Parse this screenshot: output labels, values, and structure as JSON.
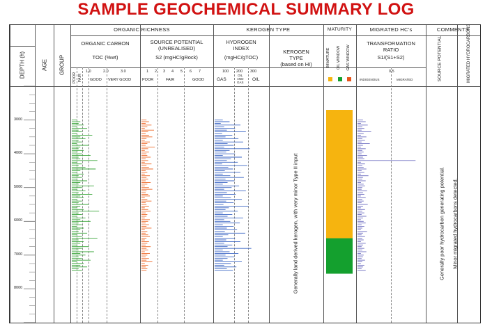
{
  "title": "SAMPLE GEOCHEMICAL SUMMARY LOG",
  "header": {
    "depth_label": "DEPTH (ft)",
    "age_label": "AGE",
    "group_label": "GROUP",
    "organic_richness": "ORGANIC RICHNESS",
    "kerogen_type": "KEROGEN TYPE",
    "maturity": "MATURITY",
    "migrated": "MIGRATED HC's",
    "comments": "COMMENTS"
  },
  "columns": {
    "organic_carbon": {
      "title": "ORGANIC CARBON",
      "unit": "TOC (%wt)",
      "ticks": [
        "1.0",
        "2.0",
        "3.0"
      ],
      "classes": [
        "POOR",
        "FAIR",
        "GOOD",
        "VERY GOOD"
      ]
    },
    "source_potential": {
      "title_1": "SOURCE POTENTIAL",
      "title_2": "(UNREALISED)",
      "unit": "S2 (mgHC/gRock)",
      "ticks": [
        "1",
        "2",
        "3",
        "4",
        "5",
        "6",
        "7"
      ],
      "classes": [
        "POOR",
        "FAIR",
        "GOOD"
      ]
    },
    "hydrogen_index": {
      "title_1": "HYDROGEN",
      "title_2": "INDEX",
      "unit": "(mgHC/gTOC)",
      "ticks": [
        "100",
        "200",
        "300"
      ],
      "classes": [
        "GAS",
        "OIL",
        "AND",
        "GAS",
        "OIL"
      ]
    },
    "kerogen": {
      "title_1": "KEROGEN",
      "title_2": "TYPE",
      "title_3": "(based on HI)"
    },
    "maturity": {
      "immature": "IMMATURE",
      "oil": "OIL WINDOW",
      "gas": "GAS WINDOW"
    },
    "transformation": {
      "title_1": "TRANSFORMATION",
      "title_2": "RATIO",
      "unit": "S1/(S1+S2)",
      "tick": "0.5",
      "classes": [
        "INDIGENOUS",
        "MIGRATED"
      ]
    },
    "source_potential_comment": "SOURCE POTENTIAL",
    "migrated_comment": "MIGRATED HYDROCARBONS"
  },
  "comments": {
    "kerogen_text": "Generally land derived kerogen, with very minor Type II input",
    "source_text": "Generally poor hydrocarbon generating potential.",
    "migrated_text": "Minor migrated hydrocarbons detected."
  },
  "depth_ticks": [
    "3000",
    "4000",
    "5000",
    "6000",
    "7000",
    "8000"
  ],
  "colors": {
    "title": "#d11212",
    "toc": "#3aa63a",
    "s2": "#ee6a2a",
    "hi": "#3b66c4",
    "tr": "#6c6cc0",
    "immature": "#f6b40f",
    "oil_window": "#14a02e",
    "gas_window": "#e8541a"
  },
  "chart_data": {
    "type": "bar",
    "title": "SAMPLE GEOCHEMICAL SUMMARY LOG",
    "ylabel": "DEPTH (ft)",
    "ylim": [
      2000,
      9000
    ],
    "maturity_zones": [
      {
        "name": "IMMATURE",
        "from": 2700,
        "to": 6500,
        "color": "#f6b40f"
      },
      {
        "name": "OIL WINDOW",
        "from": 6500,
        "to": 7550,
        "color": "#14a02e"
      }
    ],
    "series": [
      {
        "name": "TOC (%wt)",
        "xlim": [
          0,
          4
        ],
        "depth": [
          3000,
          3050,
          3100,
          3150,
          3200,
          3250,
          3300,
          3350,
          3400,
          3450,
          3500,
          3550,
          3600,
          3650,
          3700,
          3750,
          3800,
          3850,
          3900,
          3950,
          4000,
          4050,
          4100,
          4150,
          4200,
          4250,
          4300,
          4350,
          4400,
          4450,
          4500,
          4550,
          4600,
          4650,
          4700,
          4750,
          4800,
          4850,
          4900,
          4950,
          5000,
          5050,
          5100,
          5150,
          5200,
          5250,
          5300,
          5350,
          5400,
          5450,
          5500,
          5550,
          5600,
          5650,
          5700,
          5750,
          5800,
          5850,
          5900,
          5950,
          6000,
          6050,
          6100,
          6150,
          6200,
          6250,
          6300,
          6350,
          6400,
          6450,
          6500,
          6550,
          6600,
          6650,
          6700,
          6750,
          6800,
          6850,
          6900,
          6950,
          7000,
          7050,
          7100,
          7150,
          7200,
          7250,
          7300,
          7350,
          7400,
          7450
        ],
        "values": [
          0.3,
          0.5,
          0.4,
          0.7,
          0.3,
          0.9,
          0.4,
          0.6,
          0.3,
          1.2,
          0.5,
          0.8,
          0.4,
          0.6,
          0.3,
          1.0,
          0.5,
          0.4,
          0.7,
          0.3,
          0.6,
          1.1,
          0.4,
          0.5,
          1.5,
          0.3,
          0.6,
          0.4,
          0.8,
          1.4,
          0.5,
          0.3,
          0.7,
          0.4,
          0.6,
          0.3,
          0.9,
          0.5,
          0.4,
          1.3,
          0.6,
          0.3,
          0.8,
          0.4,
          1.2,
          0.5,
          0.7,
          0.3,
          0.6,
          0.4,
          1.0,
          0.5,
          0.3,
          0.7,
          1.6,
          0.4,
          0.6,
          0.3,
          0.8,
          0.5,
          1.1,
          0.4,
          0.6,
          0.3,
          0.7,
          0.5,
          0.4,
          0.9,
          0.3,
          0.6,
          1.5,
          0.4,
          0.7,
          0.5,
          0.3,
          1.0,
          0.6,
          0.4,
          1.3,
          0.5,
          0.8,
          0.4,
          0.6,
          1.1,
          0.3,
          0.7,
          0.5,
          0.9,
          0.4,
          0.6
        ]
      },
      {
        "name": "S2 (mgHC/gRock)",
        "xlim": [
          0,
          8
        ],
        "depth": [
          3000,
          3050,
          3100,
          3150,
          3200,
          3250,
          3300,
          3350,
          3400,
          3450,
          3500,
          3550,
          3600,
          3650,
          3700,
          3750,
          3800,
          3850,
          3900,
          3950,
          4000,
          4050,
          4100,
          4150,
          4200,
          4250,
          4300,
          4350,
          4400,
          4450,
          4500,
          4550,
          4600,
          4650,
          4700,
          4750,
          4800,
          4850,
          4900,
          4950,
          5000,
          5050,
          5100,
          5150,
          5200,
          5250,
          5300,
          5350,
          5400,
          5450,
          5500,
          5550,
          5600,
          5650,
          5700,
          5750,
          5800,
          5850,
          5900,
          5950,
          6000,
          6050,
          6100,
          6150,
          6200,
          6250,
          6300,
          6350,
          6400,
          6450,
          6500,
          6550,
          6600,
          6650,
          6700,
          6750,
          6800,
          6850,
          6900,
          6950,
          7000,
          7050,
          7100,
          7150,
          7200,
          7250,
          7300,
          7350,
          7400,
          7450
        ],
        "values": [
          0.6,
          0.9,
          0.5,
          1.2,
          0.7,
          0.4,
          1.5,
          0.8,
          0.5,
          0.9,
          1.3,
          0.6,
          0.4,
          1.0,
          0.7,
          0.5,
          1.6,
          0.8,
          0.4,
          0.9,
          0.6,
          0.7,
          1.1,
          0.5,
          0.8,
          0.4,
          1.2,
          0.6,
          0.9,
          1.4,
          0.5,
          0.7,
          0.4,
          1.0,
          0.6,
          0.8,
          0.5,
          1.1,
          0.7,
          0.4,
          0.9,
          1.3,
          0.6,
          0.5,
          0.8,
          1.0,
          0.4,
          0.7,
          1.2,
          0.5,
          0.6,
          0.9,
          0.4,
          0.8,
          1.1,
          0.5,
          0.7,
          0.6,
          0.4,
          1.0,
          0.8,
          0.5,
          0.9,
          0.6,
          1.2,
          0.4,
          0.7,
          0.5,
          0.8,
          1.0,
          0.6,
          0.4,
          0.9,
          0.7,
          0.5,
          1.1,
          0.6,
          0.8,
          0.4,
          1.0,
          0.7,
          0.5,
          0.9,
          0.6,
          1.3,
          0.4,
          0.8,
          0.5,
          0.7,
          0.6
        ]
      },
      {
        "name": "HI (mgHC/gTOC)",
        "xlim": [
          0,
          400
        ],
        "depth": [
          3000,
          3050,
          3100,
          3150,
          3200,
          3250,
          3300,
          3350,
          3400,
          3450,
          3500,
          3550,
          3600,
          3650,
          3700,
          3750,
          3800,
          3850,
          3900,
          3950,
          4000,
          4050,
          4100,
          4150,
          4200,
          4250,
          4300,
          4350,
          4400,
          4450,
          4500,
          4550,
          4600,
          4650,
          4700,
          4750,
          4800,
          4850,
          4900,
          4950,
          5000,
          5050,
          5100,
          5150,
          5200,
          5250,
          5300,
          5350,
          5400,
          5450,
          5500,
          5550,
          5600,
          5650,
          5700,
          5750,
          5800,
          5850,
          5900,
          5950,
          6000,
          6050,
          6100,
          6150,
          6200,
          6250,
          6300,
          6350,
          6400,
          6450,
          6500,
          6550,
          6600,
          6650,
          6700,
          6750,
          6800,
          6850,
          6900,
          6950,
          7000,
          7050,
          7100,
          7150,
          7200,
          7250,
          7300,
          7350,
          7400,
          7450
        ],
        "values": [
          60,
          110,
          45,
          190,
          70,
          150,
          90,
          230,
          55,
          130,
          80,
          175,
          60,
          210,
          95,
          140,
          70,
          260,
          110,
          85,
          150,
          60,
          200,
          120,
          90,
          170,
          55,
          240,
          100,
          135,
          75,
          190,
          60,
          115,
          215,
          80,
          145,
          95,
          60,
          180,
          125,
          70,
          230,
          90,
          155,
          60,
          120,
          200,
          85,
          140,
          65,
          250,
          105,
          80,
          170,
          60,
          130,
          95,
          210,
          70,
          115,
          185,
          60,
          140,
          90,
          165,
          75,
          225,
          100,
          60,
          150,
          85,
          190,
          70,
          130,
          95,
          270,
          60,
          110,
          175,
          80,
          145,
          95,
          60,
          200,
          120,
          70,
          160,
          90,
          135
        ]
      },
      {
        "name": "S1/(S1+S2)",
        "xlim": [
          0,
          1
        ],
        "depth": [
          3000,
          3050,
          3100,
          3150,
          3200,
          3250,
          3300,
          3350,
          3400,
          3450,
          3500,
          3550,
          3600,
          3650,
          3700,
          3750,
          3800,
          3850,
          3900,
          3950,
          4000,
          4050,
          4100,
          4150,
          4200,
          4250,
          4300,
          4350,
          4400,
          4450,
          4500,
          4550,
          4600,
          4650,
          4700,
          4750,
          4800,
          4850,
          4900,
          4950,
          5000,
          5050,
          5100,
          5150,
          5200,
          5250,
          5300,
          5350,
          5400,
          5450,
          5500,
          5550,
          5600,
          5650,
          5700,
          5750,
          5800,
          5850,
          5900,
          5950,
          6000,
          6050,
          6100,
          6150,
          6200,
          6250,
          6300,
          6350,
          6400,
          6450,
          6500,
          6550,
          6600,
          6650,
          6700,
          6750,
          6800,
          6850,
          6900,
          6950,
          7000,
          7050,
          7100,
          7150,
          7200,
          7250,
          7300,
          7350,
          7400,
          7450
        ],
        "values": [
          0.08,
          0.12,
          0.05,
          0.15,
          0.07,
          0.1,
          0.06,
          0.2,
          0.09,
          0.05,
          0.13,
          0.07,
          0.11,
          0.06,
          0.18,
          0.08,
          0.05,
          0.12,
          0.07,
          0.09,
          0.06,
          0.14,
          0.08,
          0.1,
          0.85,
          0.05,
          0.11,
          0.07,
          0.09,
          0.13,
          0.06,
          0.1,
          0.05,
          0.16,
          0.08,
          0.07,
          0.12,
          0.05,
          0.09,
          0.11,
          0.07,
          0.06,
          0.14,
          0.08,
          0.1,
          0.05,
          0.12,
          0.07,
          0.09,
          0.06,
          0.15,
          0.08,
          0.05,
          0.11,
          0.07,
          0.1,
          0.06,
          0.13,
          0.08,
          0.05,
          0.09,
          0.12,
          0.06,
          0.1,
          0.07,
          0.05,
          0.14,
          0.08,
          0.06,
          0.11,
          0.07,
          0.09,
          0.05,
          0.12,
          0.08,
          0.06,
          0.1,
          0.07,
          0.13,
          0.05,
          0.09,
          0.08,
          0.06,
          0.11,
          0.07,
          0.05,
          0.1,
          0.08,
          0.06,
          0.12
        ]
      }
    ]
  }
}
